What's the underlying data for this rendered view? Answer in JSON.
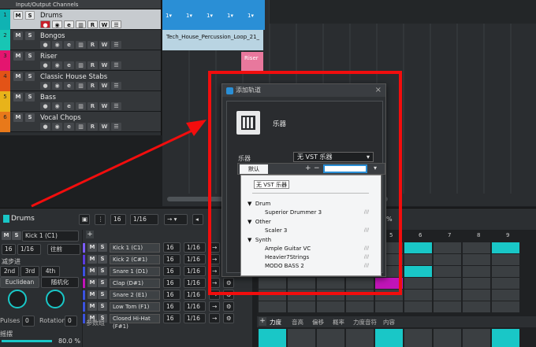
{
  "tracklist": {
    "header": "Input/Output Channels",
    "tracks": [
      {
        "num": "1",
        "name": "Drums",
        "color": "#0fb3b3",
        "selected": true
      },
      {
        "num": "2",
        "name": "Bongos",
        "color": "#18c6b4",
        "selected": false
      },
      {
        "num": "3",
        "name": "Riser",
        "color": "#e4156f",
        "selected": false
      },
      {
        "num": "4",
        "name": "Classic House Stabs",
        "color": "#e35317",
        "selected": false
      },
      {
        "num": "5",
        "name": "Bass",
        "color": "#e8b31a",
        "selected": false
      },
      {
        "num": "6",
        "name": "Vocal Chops",
        "color": "#e8791a",
        "selected": false
      }
    ],
    "m_label": "M",
    "s_label": "S",
    "r_label": "R",
    "w_label": "W"
  },
  "arrange": {
    "clip_loop": "Tech_House_Percussion_Loop_21_",
    "clip_riser": "Riser",
    "clip_markers": [
      "1▾",
      "1▾",
      "1▾",
      "1▾",
      "1▾"
    ]
  },
  "editor": {
    "track_name": "Drums",
    "quantize_value": "16",
    "quantize_div": "1/16",
    "kick_select": "Kick 1 (C1)",
    "left_val": "16",
    "left_div": "1/16",
    "goto_label": "往前",
    "mode_label": "减步进",
    "tab_2nd": "2nd",
    "tab_3rd": "3rd",
    "tab_4th": "4th",
    "euclidean": "Euclidean",
    "random_label": "随机化",
    "pulses_label": "Pulses",
    "pulses_val": "0",
    "rotation_label": "Rotation",
    "rotation_val": "0",
    "swing_label": "摇摆",
    "swing_val": "80.0 %",
    "pct_readout": "%",
    "params_label": "参数组",
    "lanes": [
      {
        "name": "Kick 1 (C1)",
        "val": "16",
        "div": "1/16"
      },
      {
        "name": "Kick 2 (C#1)",
        "val": "16",
        "div": "1/16"
      },
      {
        "name": "Snare 1 (D1)",
        "val": "16",
        "div": "1/16"
      },
      {
        "name": "Clap (D#1)",
        "val": "16",
        "div": "1/16"
      },
      {
        "name": "Snare 2 (E1)",
        "val": "16",
        "div": "1/16"
      },
      {
        "name": "Low Tom (F1)",
        "val": "16",
        "div": "1/16"
      },
      {
        "name": "Closed Hi-Hat (F#1)",
        "val": "16",
        "div": "1/16"
      }
    ],
    "grid_numbers": [
      "5",
      "6",
      "7",
      "8",
      "9"
    ],
    "bottom_tabs": [
      "力度",
      "音高",
      "偏移",
      "概率",
      "力度音符",
      "内容"
    ]
  },
  "dialog": {
    "title": "添加轨道",
    "category": "乐器",
    "instrument_label": "乐器",
    "instrument_value": "无 VST 乐器",
    "tab_default": "默认",
    "plus": "+",
    "minus": "−",
    "search_placeholder": "",
    "list": {
      "top": "无 VST 乐器",
      "groups": [
        {
          "name": "Drum",
          "items": [
            "Superior Drummer 3"
          ]
        },
        {
          "name": "Other",
          "items": [
            "Scaler 3"
          ]
        },
        {
          "name": "Synth",
          "items": [
            "Ample Guitar VC",
            "Heavier7Strings",
            "MODO BASS 2"
          ]
        }
      ]
    }
  },
  "colors": {
    "accent_cyan": "#19c7c7",
    "highlight_red": "#f20d0d",
    "magenta": "#c114b8"
  }
}
